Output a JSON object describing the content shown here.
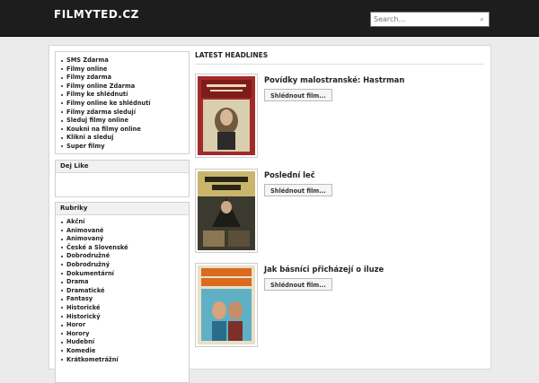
{
  "site": {
    "logo": "FILMYTED.CZ"
  },
  "search": {
    "placeholder": "Search...",
    "icon": "search-icon"
  },
  "sidebar": {
    "links": [
      "SMS Zdarma",
      "Filmy online",
      "Filmy zdarma",
      "Filmy online Zdarma",
      "Filmy ke shlédnutí",
      "Filmy online ke shlédnutí",
      "Filmy zdarma sledují",
      "Sleduj filmy online",
      "Koukni na filmy online",
      "Klikni a sleduj",
      "Super filmy"
    ],
    "like_box": {
      "title": "Dej Like"
    },
    "rubriky": {
      "title": "Rubriky",
      "items": [
        "Akční",
        "Animované",
        "Animovaný",
        "České a Slovenské",
        "Dobrodružné",
        "Dobrodružný",
        "Dokumentární",
        "Drama",
        "Dramatické",
        "Fantasy",
        "Historické",
        "Historický",
        "Horor",
        "Horory",
        "Hudební",
        "Komedie",
        "Krátkometrážní"
      ]
    }
  },
  "main": {
    "heading": "LATEST HEADLINES",
    "films": [
      {
        "title": "Povídky malostranské: Hastrman",
        "button": "Shlédnout film...",
        "poster_colors": [
          "#a32a2a",
          "#d9cfae"
        ]
      },
      {
        "title": "Poslední leč",
        "button": "Shlédnout film...",
        "poster_colors": [
          "#3c3a2e",
          "#c9b56c"
        ]
      },
      {
        "title": "Jak básníci přicházejí o iluze",
        "button": "Shlédnout film...",
        "poster_colors": [
          "#d96a1f",
          "#5fb0c4"
        ]
      }
    ]
  }
}
